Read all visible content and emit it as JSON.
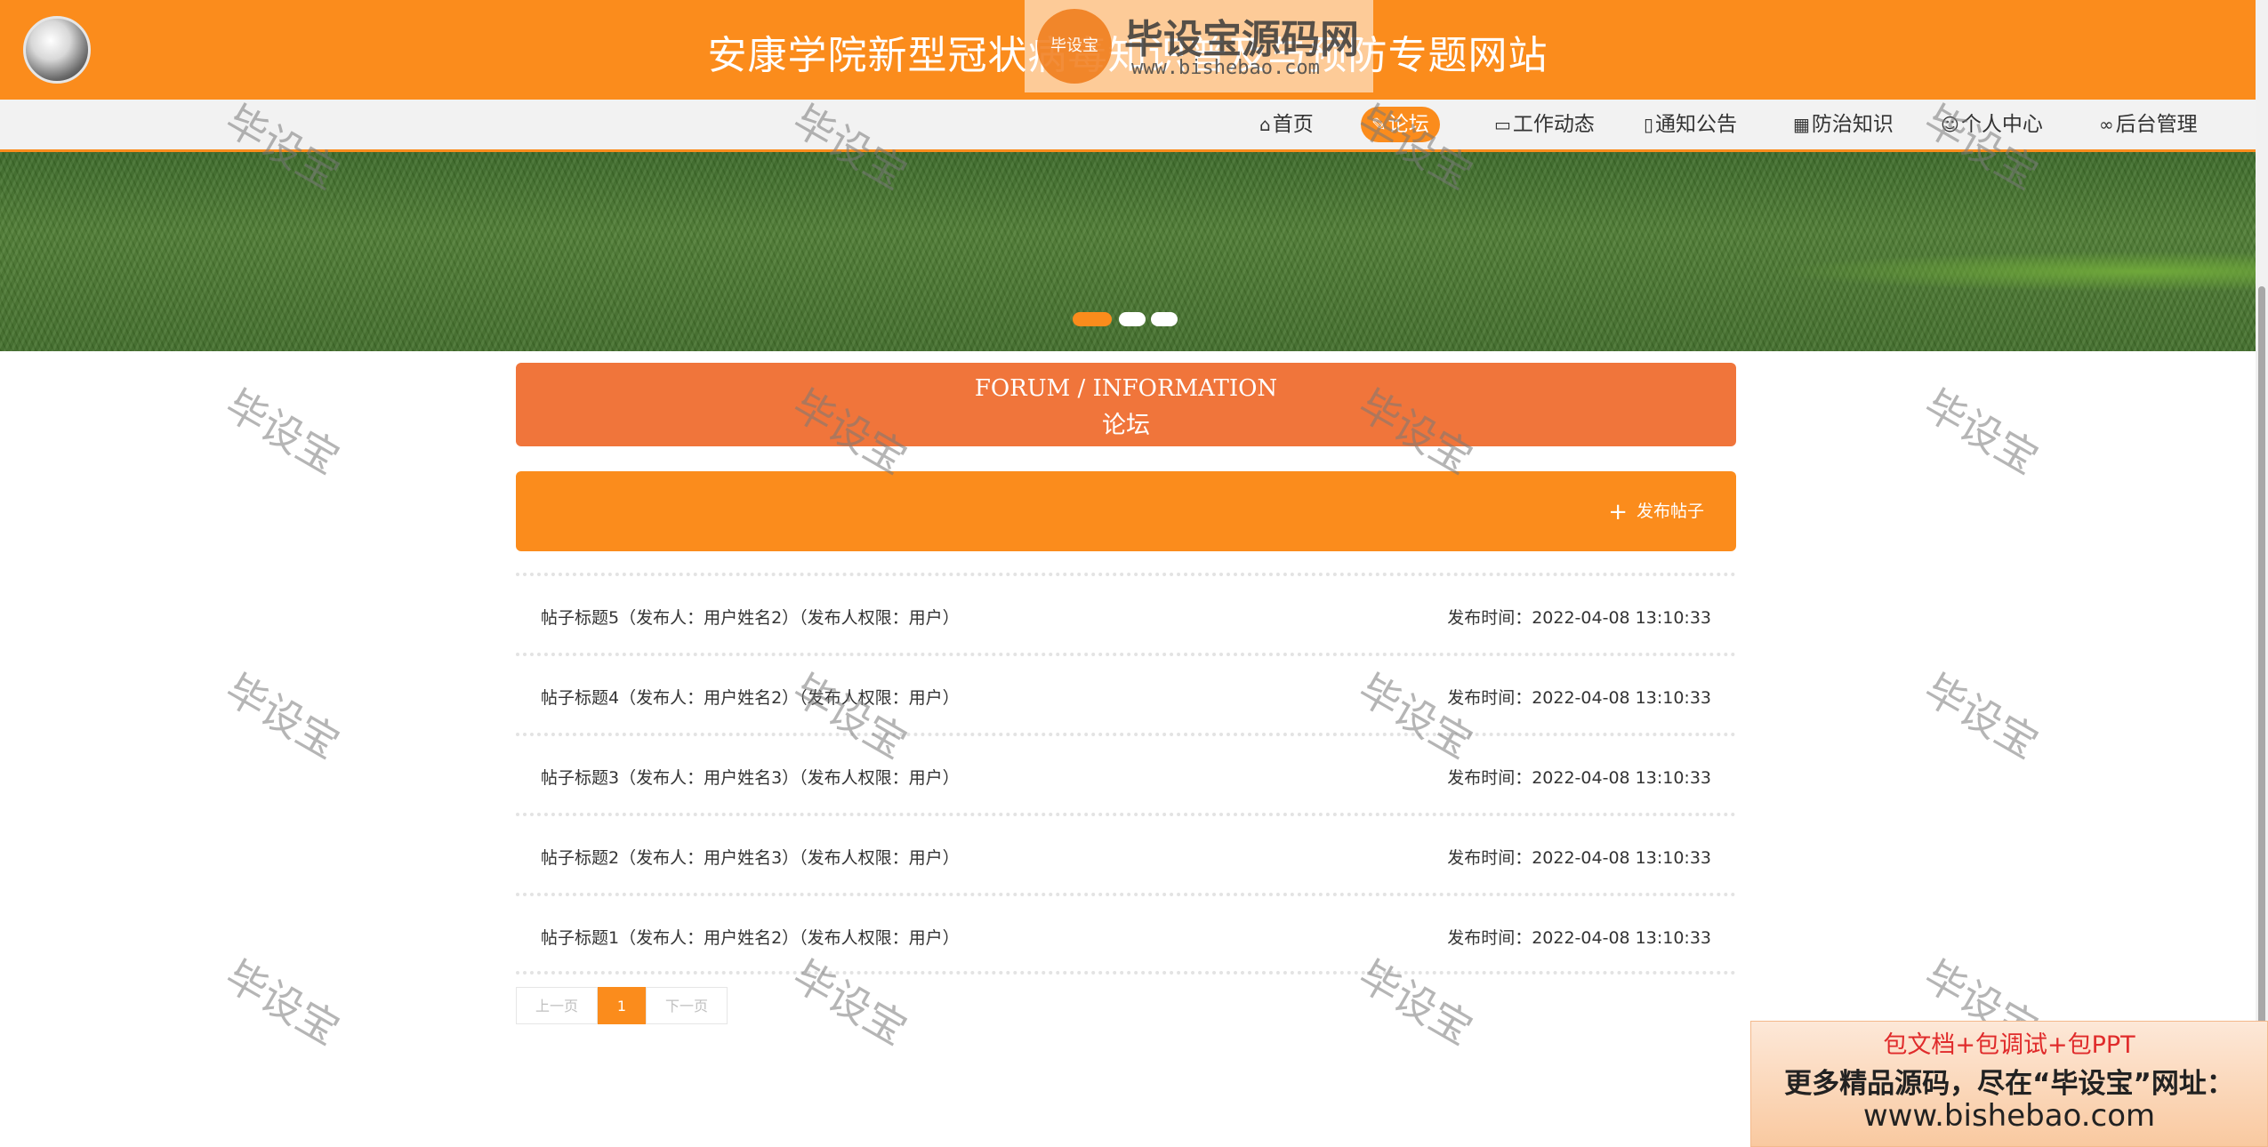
{
  "header": {
    "site_title": "安康学院新型冠状病毒知识普及与预防专题网站"
  },
  "watermark_logo": {
    "badge_text": "毕设宝",
    "big_text": "毕设宝源码网",
    "url_text": "www.bishebao.com"
  },
  "nav": {
    "items": [
      {
        "label": "首页",
        "icon": "home-icon",
        "active": false
      },
      {
        "label": "论坛",
        "icon": "forum-icon",
        "active": true
      },
      {
        "label": "工作动态",
        "icon": "book-icon",
        "active": false
      },
      {
        "label": "通知公告",
        "icon": "document-icon",
        "active": false
      },
      {
        "label": "防治知识",
        "icon": "grid-icon",
        "active": false
      },
      {
        "label": "个人中心",
        "icon": "user-icon",
        "active": false
      },
      {
        "label": "后台管理",
        "icon": "link-icon",
        "active": false
      }
    ]
  },
  "section": {
    "title_en": "FORUM / INFORMATION",
    "title_zh": "论坛"
  },
  "actions": {
    "post_label": "发布帖子"
  },
  "posts": [
    {
      "title": "帖子标题5（发布人：用户姓名2）（发布人权限：用户）",
      "time": "发布时间：2022-04-08 13:10:33"
    },
    {
      "title": "帖子标题4（发布人：用户姓名2）（发布人权限：用户）",
      "time": "发布时间：2022-04-08 13:10:33"
    },
    {
      "title": "帖子标题3（发布人：用户姓名3）（发布人权限：用户）",
      "time": "发布时间：2022-04-08 13:10:33"
    },
    {
      "title": "帖子标题2（发布人：用户姓名3）（发布人权限：用户）",
      "time": "发布时间：2022-04-08 13:10:33"
    },
    {
      "title": "帖子标题1（发布人：用户姓名2）（发布人权限：用户）",
      "time": "发布时间：2022-04-08 13:10:33"
    }
  ],
  "pagination": {
    "prev": "上一页",
    "current": "1",
    "next": "下一页"
  },
  "watermark_text": "毕设宝",
  "promo": {
    "line1": "包文档+包调试+包PPT",
    "line2": "更多精品源码，尽在“毕设宝”网址：",
    "line3": "www.bishebao.com"
  },
  "colors": {
    "accent": "#fb8c1c",
    "section_head": "#f0753b"
  }
}
